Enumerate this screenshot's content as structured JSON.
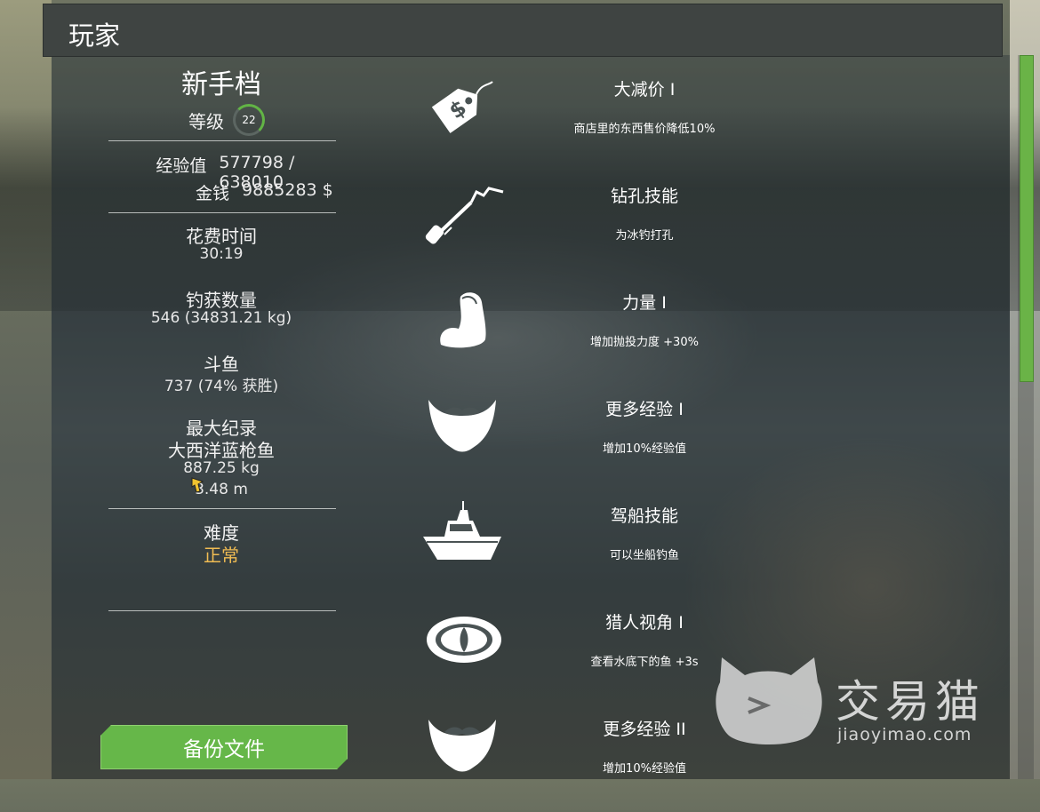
{
  "header": {
    "title": "玩家"
  },
  "profile": {
    "name": "新手档",
    "level_label": "等级",
    "level_value": "22",
    "level_progress": 0.9
  },
  "stats": {
    "experience": {
      "label": "经验值",
      "value": "577798 / 638010"
    },
    "money": {
      "label": "金钱",
      "value": "9885283 $"
    },
    "time_spent": {
      "label": "花费时间",
      "value": "30:19"
    },
    "fish_caught": {
      "label": "钓获数量",
      "value": "546 (34831.21 kg)"
    },
    "fish_fight": {
      "label": "斗鱼",
      "value": "737 (74% 获胜)"
    },
    "record": {
      "label": "最大纪录",
      "species": "大西洋蓝枪鱼",
      "weight": "887.25 kg",
      "length": "3.48 m"
    },
    "difficulty": {
      "label": "难度",
      "value": "正常"
    }
  },
  "buttons": {
    "backup": "备份文件"
  },
  "skills": [
    {
      "title": "大减价 I",
      "desc": "商店里的东西售价降低10%",
      "icon": "price-tag-icon"
    },
    {
      "title": "钻孔技能",
      "desc": "为冰钓打孔",
      "icon": "ice-drill-icon"
    },
    {
      "title": "力量 I",
      "desc": "增加抛投力度 +30%",
      "icon": "flexed-arm-icon"
    },
    {
      "title": "更多经验 I",
      "desc": "增加10%经验值",
      "icon": "beard-icon"
    },
    {
      "title": "驾船技能",
      "desc": "可以坐船钓鱼",
      "icon": "boat-icon"
    },
    {
      "title": "猎人视角 I",
      "desc": "查看水底下的鱼 +3s",
      "icon": "eye-icon"
    },
    {
      "title": "更多经验 II",
      "desc": "增加10%经验值",
      "icon": "beard-icon"
    }
  ],
  "watermark": {
    "brand": "交易猫",
    "url": "jiaoyimao.com"
  },
  "colors": {
    "accent_green": "#66b749",
    "difficulty_gold": "#f0bc53",
    "header_bg": "#3f4442"
  }
}
